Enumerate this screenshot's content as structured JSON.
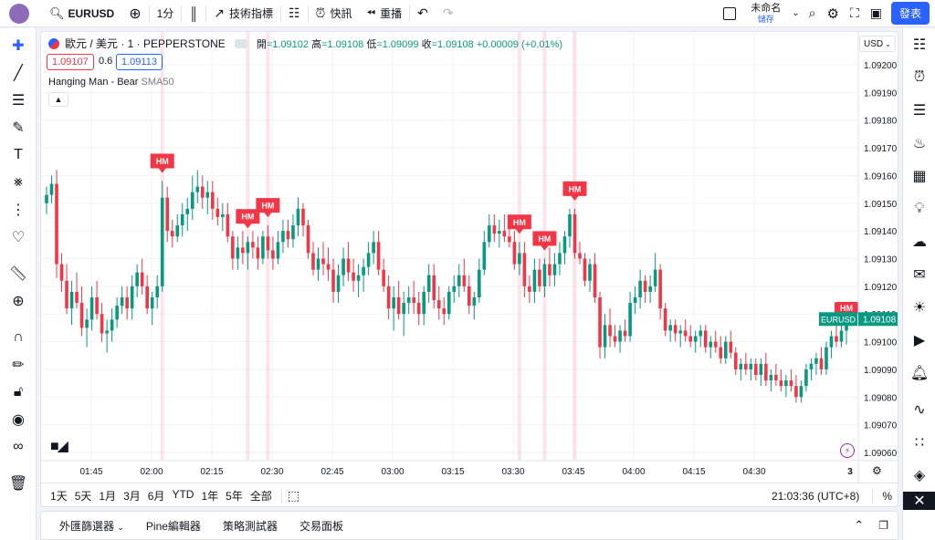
{
  "topbar": {
    "symbol": "EURUSD",
    "interval": "1分",
    "indicators_label": "技術指標",
    "alert_label": "快訊",
    "replay_label": "重播",
    "layout_name": "未命名",
    "layout_save": "儲存",
    "publish_label": "發表"
  },
  "legend": {
    "title": "歐元 / 美元 · 1 · PEPPERSTONE",
    "o_label": "開",
    "o": "=1.09102",
    "h_label": "高",
    "h": "=1.09108",
    "l_label": "低",
    "l": "=1.09099",
    "c_label": "收",
    "c": "=1.09108",
    "chg": "+0.00009 (+0.01%)",
    "bid": "1.09107",
    "spread": "0.6",
    "ask": "1.09113"
  },
  "indicator": {
    "name": "Hanging Man - Bear",
    "param": "SMA50"
  },
  "colors": {
    "up": "#089981",
    "down": "#f23645",
    "accent": "#2962ff",
    "marker": "#f23645"
  },
  "axis": {
    "currency": "USD",
    "y_ticks": [
      "1.09200",
      "1.09190",
      "1.09180",
      "1.09170",
      "1.09160",
      "1.09150",
      "1.09140",
      "1.09130",
      "1.09120",
      "1.09110",
      "1.09100",
      "1.09090",
      "1.09080",
      "1.09070",
      "1.09060"
    ],
    "x_ticks": [
      "01:45",
      "02:00",
      "02:15",
      "02:30",
      "02:45",
      "03:00",
      "03:15",
      "03:30",
      "03:45",
      "04:00",
      "04:15",
      "04:30"
    ],
    "last_symbol": "EURUSD",
    "last_price": "1.09108",
    "right_corner": "3"
  },
  "markers": {
    "label": "HM"
  },
  "ranges": [
    "1天",
    "5天",
    "1月",
    "3月",
    "6月",
    "YTD",
    "1年",
    "5年",
    "全部"
  ],
  "clock": "21:03:36 (UTC+8)",
  "percent_label": "%",
  "bottom_tabs": [
    "外匯篩選器",
    "Pine編輯器",
    "策略測試器",
    "交易面板"
  ],
  "chart_data": {
    "type": "candlestick",
    "ylim": [
      1.09055,
      1.09205
    ],
    "candles": [
      [
        1.0915,
        1.09156,
        1.09146,
        1.09153
      ],
      [
        1.09153,
        1.0916,
        1.0915,
        1.09157
      ],
      [
        1.09157,
        1.09162,
        1.09123,
        1.09128
      ],
      [
        1.09128,
        1.09132,
        1.09118,
        1.09122
      ],
      [
        1.09122,
        1.09128,
        1.0911,
        1.09112
      ],
      [
        1.09112,
        1.09122,
        1.09106,
        1.09118
      ],
      [
        1.09118,
        1.09125,
        1.09112,
        1.09114
      ],
      [
        1.09114,
        1.0912,
        1.09102,
        1.09105
      ],
      [
        1.09105,
        1.09112,
        1.09098,
        1.09108
      ],
      [
        1.09108,
        1.0912,
        1.09104,
        1.09116
      ],
      [
        1.09116,
        1.09122,
        1.09108,
        1.0911
      ],
      [
        1.0911,
        1.09114,
        1.091,
        1.09103
      ],
      [
        1.09103,
        1.09108,
        1.09096,
        1.09104
      ],
      [
        1.09104,
        1.09112,
        1.091,
        1.09108
      ],
      [
        1.09108,
        1.09116,
        1.09105,
        1.09113
      ],
      [
        1.09113,
        1.0912,
        1.0911,
        1.09116
      ],
      [
        1.09116,
        1.0912,
        1.09108,
        1.09112
      ],
      [
        1.09112,
        1.09124,
        1.09108,
        1.0912
      ],
      [
        1.0912,
        1.09128,
        1.09116,
        1.09125
      ],
      [
        1.09125,
        1.0913,
        1.09117,
        1.0912
      ],
      [
        1.0912,
        1.09124,
        1.0911,
        1.09112
      ],
      [
        1.09112,
        1.09118,
        1.09106,
        1.09116
      ],
      [
        1.09116,
        1.09124,
        1.09112,
        1.0912
      ],
      [
        1.0912,
        1.09158,
        1.09118,
        1.09152
      ],
      [
        1.09152,
        1.09156,
        1.09136,
        1.0914
      ],
      [
        1.0914,
        1.09144,
        1.09134,
        1.09138
      ],
      [
        1.09138,
        1.09146,
        1.09136,
        1.09142
      ],
      [
        1.09142,
        1.0915,
        1.09138,
        1.09146
      ],
      [
        1.09146,
        1.09152,
        1.0914,
        1.09148
      ],
      [
        1.09148,
        1.0916,
        1.09144,
        1.09154
      ],
      [
        1.09154,
        1.09162,
        1.0915,
        1.09156
      ],
      [
        1.09156,
        1.0916,
        1.09148,
        1.09152
      ],
      [
        1.09152,
        1.09158,
        1.09146,
        1.09154
      ],
      [
        1.09154,
        1.09158,
        1.09144,
        1.09148
      ],
      [
        1.09148,
        1.09152,
        1.09142,
        1.09145
      ],
      [
        1.09145,
        1.0915,
        1.0914,
        1.09146
      ],
      [
        1.09146,
        1.0915,
        1.09136,
        1.09138
      ],
      [
        1.09138,
        1.0914,
        1.09126,
        1.0913
      ],
      [
        1.0913,
        1.09138,
        1.09126,
        1.09134
      ],
      [
        1.09134,
        1.0914,
        1.09128,
        1.09132
      ],
      [
        1.09132,
        1.09138,
        1.09126,
        1.09136
      ],
      [
        1.09136,
        1.0914,
        1.0913,
        1.09134
      ],
      [
        1.09134,
        1.09138,
        1.09126,
        1.0913
      ],
      [
        1.0913,
        1.0914,
        1.09128,
        1.09138
      ],
      [
        1.09138,
        1.09142,
        1.0913,
        1.09133
      ],
      [
        1.09133,
        1.09138,
        1.09126,
        1.0913
      ],
      [
        1.0913,
        1.0914,
        1.09128,
        1.09136
      ],
      [
        1.09136,
        1.09144,
        1.09132,
        1.0914
      ],
      [
        1.0914,
        1.09144,
        1.09134,
        1.09137
      ],
      [
        1.09137,
        1.09146,
        1.09134,
        1.09142
      ],
      [
        1.09142,
        1.09152,
        1.09138,
        1.09148
      ],
      [
        1.09148,
        1.0915,
        1.09138,
        1.09142
      ],
      [
        1.09142,
        1.09144,
        1.0913,
        1.09132
      ],
      [
        1.09132,
        1.09136,
        1.09124,
        1.09126
      ],
      [
        1.09126,
        1.09134,
        1.09122,
        1.0913
      ],
      [
        1.0913,
        1.09136,
        1.09124,
        1.09128
      ],
      [
        1.09128,
        1.09134,
        1.09122,
        1.09126
      ],
      [
        1.09126,
        1.0913,
        1.09114,
        1.09118
      ],
      [
        1.09118,
        1.09128,
        1.09114,
        1.09124
      ],
      [
        1.09124,
        1.09134,
        1.0912,
        1.0913
      ],
      [
        1.0913,
        1.09136,
        1.09122,
        1.09125
      ],
      [
        1.09125,
        1.0913,
        1.09118,
        1.09122
      ],
      [
        1.09122,
        1.09128,
        1.09116,
        1.09124
      ],
      [
        1.09124,
        1.0913,
        1.09118,
        1.09127
      ],
      [
        1.09127,
        1.09136,
        1.09124,
        1.09132
      ],
      [
        1.09132,
        1.0914,
        1.09128,
        1.09136
      ],
      [
        1.09136,
        1.0914,
        1.09124,
        1.09126
      ],
      [
        1.09126,
        1.0913,
        1.09118,
        1.0912
      ],
      [
        1.0912,
        1.09124,
        1.09108,
        1.09112
      ],
      [
        1.09112,
        1.0912,
        1.09104,
        1.09116
      ],
      [
        1.09116,
        1.09122,
        1.09108,
        1.0911
      ],
      [
        1.0911,
        1.09118,
        1.09102,
        1.09114
      ],
      [
        1.09114,
        1.0912,
        1.0911,
        1.09116
      ],
      [
        1.09116,
        1.09122,
        1.0911,
        1.09114
      ],
      [
        1.09114,
        1.09118,
        1.09106,
        1.0911
      ],
      [
        1.0911,
        1.0912,
        1.09106,
        1.09118
      ],
      [
        1.09118,
        1.09128,
        1.09114,
        1.09124
      ],
      [
        1.09124,
        1.09128,
        1.09112,
        1.09115
      ],
      [
        1.09115,
        1.0912,
        1.09108,
        1.09112
      ],
      [
        1.09112,
        1.09116,
        1.09106,
        1.0911
      ],
      [
        1.0911,
        1.0912,
        1.09108,
        1.09118
      ],
      [
        1.09118,
        1.09124,
        1.09114,
        1.0912
      ],
      [
        1.0912,
        1.09128,
        1.09116,
        1.09124
      ],
      [
        1.09124,
        1.0913,
        1.09118,
        1.0912
      ],
      [
        1.0912,
        1.09124,
        1.0911,
        1.09113
      ],
      [
        1.09113,
        1.09118,
        1.09108,
        1.09116
      ],
      [
        1.09116,
        1.0913,
        1.09114,
        1.09126
      ],
      [
        1.09126,
        1.0914,
        1.09124,
        1.09136
      ],
      [
        1.09136,
        1.09146,
        1.09134,
        1.09142
      ],
      [
        1.09142,
        1.09146,
        1.09136,
        1.09139
      ],
      [
        1.09139,
        1.09144,
        1.09134,
        1.0914
      ],
      [
        1.0914,
        1.09146,
        1.09136,
        1.09138
      ],
      [
        1.09138,
        1.09142,
        1.09134,
        1.09136
      ],
      [
        1.09136,
        1.0914,
        1.09126,
        1.09128
      ],
      [
        1.09128,
        1.09136,
        1.09124,
        1.09132
      ],
      [
        1.09132,
        1.09136,
        1.09116,
        1.0912
      ],
      [
        1.0912,
        1.09124,
        1.09114,
        1.09118
      ],
      [
        1.09118,
        1.0913,
        1.09114,
        1.09126
      ],
      [
        1.09126,
        1.0913,
        1.09118,
        1.0912
      ],
      [
        1.0912,
        1.0913,
        1.09116,
        1.09128
      ],
      [
        1.09128,
        1.09134,
        1.0912,
        1.09124
      ],
      [
        1.09124,
        1.09132,
        1.0912,
        1.09128
      ],
      [
        1.09128,
        1.09136,
        1.09124,
        1.09132
      ],
      [
        1.09132,
        1.0914,
        1.09128,
        1.09138
      ],
      [
        1.09138,
        1.09148,
        1.09134,
        1.09146
      ],
      [
        1.09146,
        1.09148,
        1.0913,
        1.09132
      ],
      [
        1.09132,
        1.09136,
        1.09128,
        1.0913
      ],
      [
        1.0913,
        1.09132,
        1.0912,
        1.09122
      ],
      [
        1.09122,
        1.0913,
        1.09118,
        1.09128
      ],
      [
        1.09128,
        1.09132,
        1.09114,
        1.09116
      ],
      [
        1.09116,
        1.09118,
        1.09094,
        1.09098
      ],
      [
        1.09098,
        1.0911,
        1.09094,
        1.09106
      ],
      [
        1.09106,
        1.09112,
        1.09098,
        1.09102
      ],
      [
        1.09102,
        1.09106,
        1.09098,
        1.091
      ],
      [
        1.091,
        1.09106,
        1.09096,
        1.09104
      ],
      [
        1.09104,
        1.09108,
        1.091,
        1.09102
      ],
      [
        1.09102,
        1.09118,
        1.091,
        1.09114
      ],
      [
        1.09114,
        1.0912,
        1.0911,
        1.09116
      ],
      [
        1.09116,
        1.09126,
        1.09112,
        1.09122
      ],
      [
        1.09122,
        1.09124,
        1.09114,
        1.09118
      ],
      [
        1.09118,
        1.09124,
        1.09114,
        1.0912
      ],
      [
        1.0912,
        1.09132,
        1.09118,
        1.09126
      ],
      [
        1.09126,
        1.09128,
        1.09108,
        1.09112
      ],
      [
        1.09112,
        1.09114,
        1.09102,
        1.09104
      ],
      [
        1.09104,
        1.09108,
        1.091,
        1.09106
      ],
      [
        1.09106,
        1.09108,
        1.091,
        1.09103
      ],
      [
        1.09103,
        1.09106,
        1.09098,
        1.09104
      ],
      [
        1.09104,
        1.09108,
        1.091,
        1.09102
      ],
      [
        1.09102,
        1.09106,
        1.09098,
        1.091
      ],
      [
        1.091,
        1.09104,
        1.09096,
        1.09102
      ],
      [
        1.09102,
        1.09106,
        1.09098,
        1.09104
      ],
      [
        1.09104,
        1.09106,
        1.09096,
        1.09098
      ],
      [
        1.09098,
        1.09102,
        1.09094,
        1.091
      ],
      [
        1.091,
        1.09104,
        1.09096,
        1.09098
      ],
      [
        1.09098,
        1.09102,
        1.09092,
        1.09094
      ],
      [
        1.09094,
        1.09102,
        1.09092,
        1.091
      ],
      [
        1.091,
        1.09104,
        1.09094,
        1.09096
      ],
      [
        1.09096,
        1.09098,
        1.09088,
        1.0909
      ],
      [
        1.0909,
        1.09094,
        1.09086,
        1.09092
      ],
      [
        1.09092,
        1.09096,
        1.09088,
        1.0909
      ],
      [
        1.0909,
        1.09094,
        1.09086,
        1.09092
      ],
      [
        1.09092,
        1.09094,
        1.09086,
        1.09088
      ],
      [
        1.09088,
        1.09094,
        1.09084,
        1.09092
      ],
      [
        1.09092,
        1.09096,
        1.09084,
        1.09086
      ],
      [
        1.09086,
        1.0909,
        1.09082,
        1.09088
      ],
      [
        1.09088,
        1.09092,
        1.09084,
        1.09086
      ],
      [
        1.09086,
        1.0909,
        1.09082,
        1.09084
      ],
      [
        1.09084,
        1.09088,
        1.0908,
        1.09086
      ],
      [
        1.09086,
        1.0909,
        1.09082,
        1.09084
      ],
      [
        1.09084,
        1.09088,
        1.09078,
        1.0908
      ],
      [
        1.0908,
        1.09086,
        1.09078,
        1.09084
      ],
      [
        1.09084,
        1.09092,
        1.09082,
        1.0909
      ],
      [
        1.0909,
        1.09094,
        1.09086,
        1.09092
      ],
      [
        1.09092,
        1.09096,
        1.09088,
        1.09094
      ],
      [
        1.09094,
        1.09098,
        1.09088,
        1.0909
      ],
      [
        1.0909,
        1.091,
        1.09088,
        1.09098
      ],
      [
        1.09098,
        1.09104,
        1.09094,
        1.09102
      ],
      [
        1.09102,
        1.09106,
        1.09098,
        1.091
      ],
      [
        1.091,
        1.09108,
        1.09098,
        1.09104
      ],
      [
        1.09104,
        1.09108,
        1.09099,
        1.09108
      ]
    ],
    "hm_markers": [
      23,
      40,
      44,
      94,
      99,
      105
    ],
    "highlight_bars": [
      23,
      40,
      44,
      94,
      99,
      105,
      162
    ]
  }
}
